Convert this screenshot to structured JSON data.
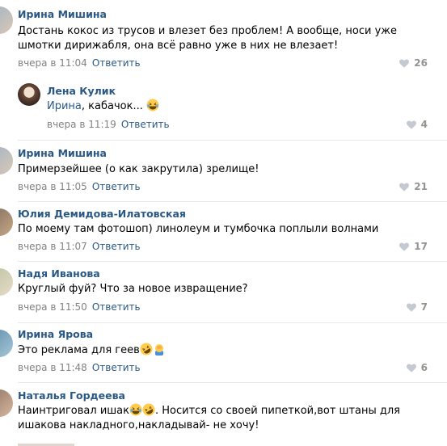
{
  "comments": [
    {
      "author": "Ирина Мишина",
      "text": "Достань кокос из трусов и влезет без проблем! А вообще, носи уже шмотки дирижабля, она всё равно уже в них не влезает!",
      "time": "вчера в 11:04",
      "reply": "Ответить",
      "likes": "26"
    },
    {
      "author": "Лена Кулик",
      "mention": "Ирина",
      "text": ", кабачок...",
      "time": "вчера в 11:19",
      "reply": "Ответить",
      "likes": "4"
    },
    {
      "author": "Ирина Мишина",
      "text": "Примерзейшее (о как закрутила) зрелище!",
      "time": "вчера в 11:05",
      "reply": "Ответить",
      "likes": "21"
    },
    {
      "author": "Юлия Демидова-Илатовская",
      "text": "По моему там фотошоп) линолеум и тумбочка поплыли волнами",
      "time": "вчера в 11:07",
      "reply": "Ответить",
      "likes": "17"
    },
    {
      "author": "Надя Иванова",
      "text": "Круглый фуй? Что за новое извращение?",
      "time": "вчера в 11:50",
      "reply": "Ответить",
      "likes": "7"
    },
    {
      "author": "Ирина Ярова",
      "text": "Это реклама для геев",
      "time": "вчера в 11:48",
      "reply": "Ответить",
      "likes": "6"
    },
    {
      "author": "Наталья Гордеева",
      "text_a": "Наинтриговал ишак",
      "text_b": ". Носится со своей пипеткой,вот штаны для ишакова накладного,накладывай- не хочу!"
    }
  ],
  "colors": {
    "link": "#2a5885",
    "meta": "#828282",
    "separator": "#e7e8ec",
    "heart": "#c5cad2"
  },
  "icons": [
    "heart-icon",
    "laughing-emoji-icon",
    "rolling-laughing-emoji-icon",
    "facepalm-emoji-icon"
  ]
}
